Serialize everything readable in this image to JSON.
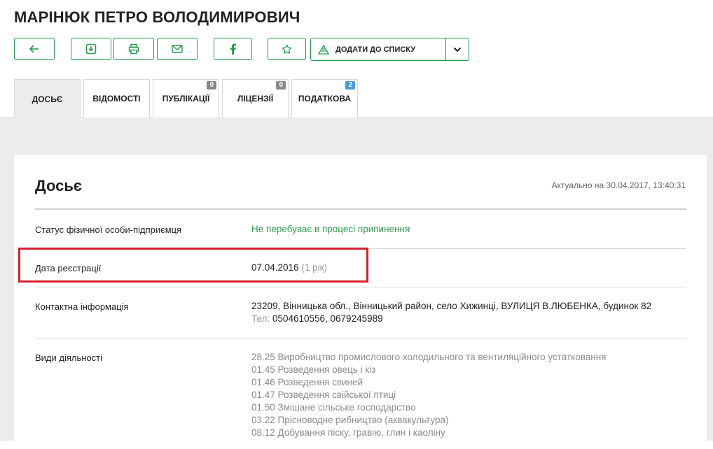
{
  "header": {
    "title": "МАРІНЮК ПЕТРО ВОЛОДИМИРОВИЧ"
  },
  "toolbar": {
    "buttons": [
      {
        "icon": "arrow-left-icon"
      },
      {
        "icon": "download-icon"
      },
      {
        "icon": "print-icon"
      },
      {
        "icon": "mail-icon"
      },
      {
        "icon": "facebook-icon"
      },
      {
        "icon": "star-icon"
      }
    ],
    "add_to_list_label": "ДОДАТИ ДО СПИСКУ",
    "accent": "#1f9a4a"
  },
  "tabs": [
    {
      "label": "ДОСЬЄ",
      "active": true
    },
    {
      "label": "ВІДОМОСТІ"
    },
    {
      "label": "ПУБЛІКАЦІЇ",
      "count": "0"
    },
    {
      "label": "ЛІЦЕНЗІЇ",
      "count": "0"
    },
    {
      "label": "ПОДАТКОВА",
      "count": "2"
    }
  ],
  "dossier": {
    "title": "Досьє",
    "actual": "Актуально на 30.04.2017, 13:40:31",
    "status": {
      "label": "Статус фізичної особи-підприємця",
      "value": "Не перебуває в процесі припинення"
    },
    "registration": {
      "label": "Дата реєстрації",
      "date": "07.04.2016",
      "age": "(1 рік)"
    },
    "contact": {
      "label": "Контактна інформація",
      "address": "23209, Вінницька обл., Вінницький район, село Хижинці, ВУЛИЦЯ В.ЛЮБЕНКА, будинок 82",
      "phone_label": "Тел:",
      "phones": "0504610556, 0679245989"
    },
    "activities": {
      "label": "Види діяльності",
      "items": [
        "28.25 Виробництво промислового холодильного та вентиляційного устатковання",
        "01.45 Розведення овець і кіз",
        "01.46 Розведення свиней",
        "01.47 Розведення свійської птиці",
        "01.50 Змішане сільське господарство",
        "03.22 Прісноводне рибництво (аквакультура)",
        "08.12 Добування піску, гравію, глин і каоліну"
      ]
    }
  }
}
